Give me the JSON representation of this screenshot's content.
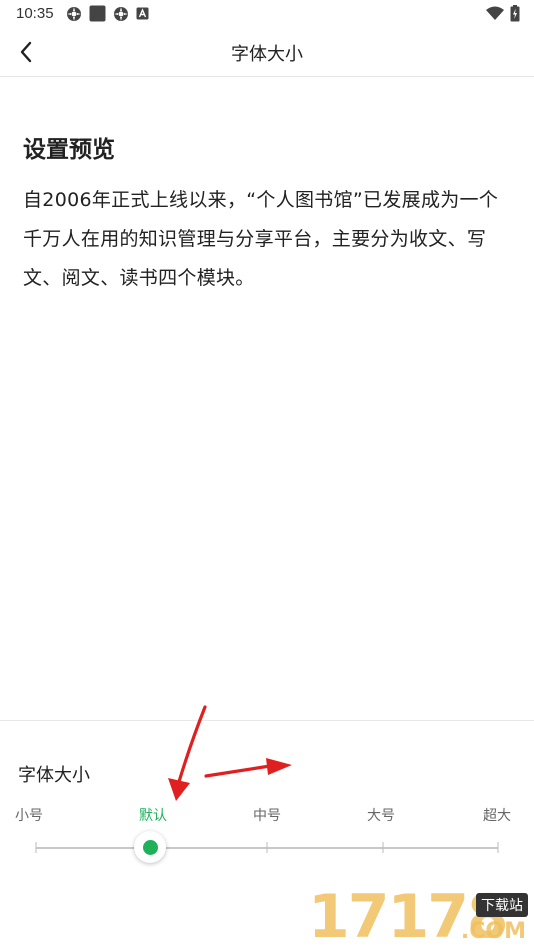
{
  "status_bar": {
    "time": "10:35",
    "left_icons": [
      "settings-gear-icon",
      "square-app-icon",
      "settings-gear-icon",
      "a-letter-icon"
    ],
    "right_icons": [
      "wifi-icon",
      "battery-icon"
    ]
  },
  "navbar": {
    "title": "字体大小",
    "back_icon": "chevron-left-icon"
  },
  "preview": {
    "heading": "设置预览",
    "body": "自2006年正式上线以来，“个人图书馆”已发展成为一个千万人在用的知识管理与分享平台，主要分为收文、写文、阅文、读书四个模块。"
  },
  "font_panel": {
    "title": "字体大小",
    "options": [
      "小号",
      "默认",
      "中号",
      "大号",
      "超大"
    ],
    "selected_index": 1,
    "accent_color": "#1fb15a"
  },
  "watermark": {
    "number": "17178",
    "badge": "下载站",
    "domain": ".COM"
  },
  "annotation_color": "#e02020"
}
